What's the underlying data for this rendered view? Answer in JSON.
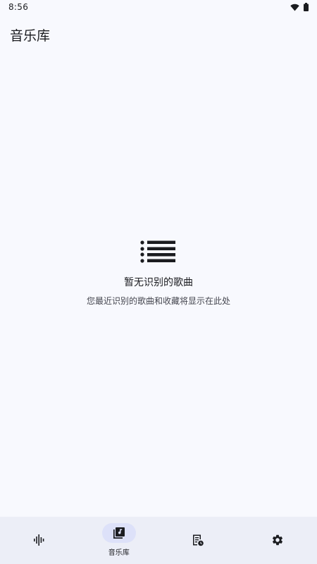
{
  "status_bar": {
    "time": "8:56",
    "icons": [
      "wifi-icon",
      "battery-icon"
    ]
  },
  "header": {
    "title": "音乐库"
  },
  "empty_state": {
    "icon": "list-icon",
    "title": "暂无识别的歌曲",
    "subtitle": "您最近识别的歌曲和收藏将显示在此处"
  },
  "bottom_nav": {
    "items": [
      {
        "icon": "audio-wave-icon",
        "label": ""
      },
      {
        "icon": "music-library-icon",
        "label": "音乐库",
        "active": true
      },
      {
        "icon": "history-icon",
        "label": ""
      },
      {
        "icon": "gear-icon",
        "label": ""
      }
    ]
  },
  "colors": {
    "background": "#f8f9fe",
    "nav_background": "#eceef7",
    "active_indicator": "#dde1f9",
    "text_primary": "#1b1c20",
    "text_secondary": "#45464f"
  }
}
